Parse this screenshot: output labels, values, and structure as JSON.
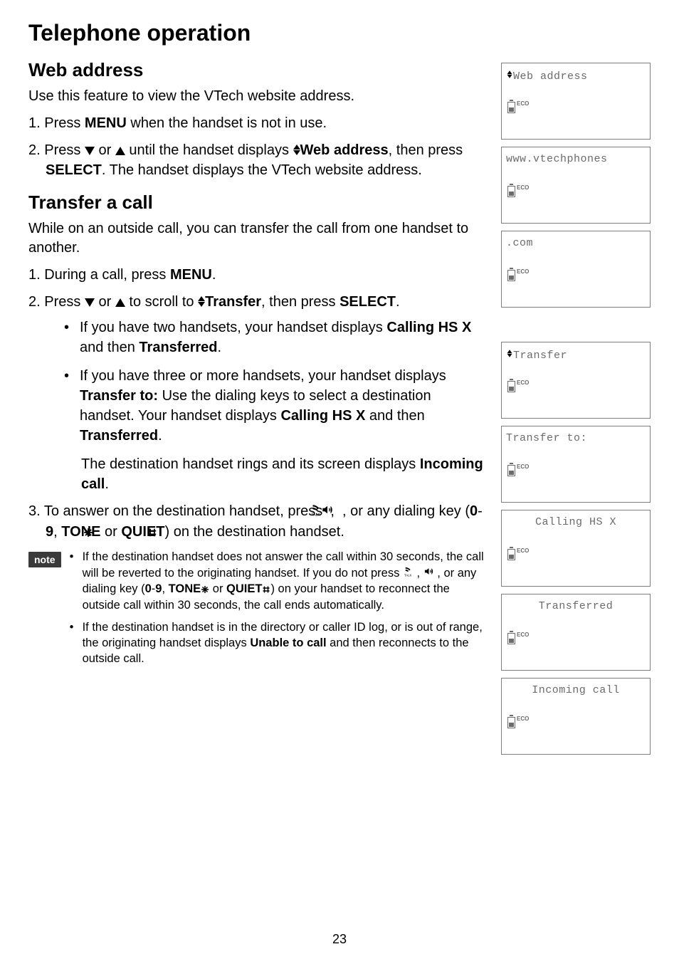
{
  "page_title": "Telephone operation",
  "page_number": "23",
  "section1": {
    "heading": "Web address",
    "intro": "Use this feature to view the VTech website address.",
    "step1_pre": "1. Press ",
    "step1_b": "MENU",
    "step1_post": " when the handset is not in use.",
    "step2_pre": "2. Press ",
    "step2_mid": " or ",
    "step2_mid2": " until the handset displays ",
    "step2_b": "Web address",
    "step2_post1": ", then press ",
    "step2_b2": "SELECT",
    "step2_post2": ". The handset displays the VTech website address."
  },
  "section2": {
    "heading": "Transfer a call",
    "intro": "While on an outside call, you can transfer the call from one handset to another.",
    "step1_pre": "1. During a call, press ",
    "step1_b": "MENU",
    "step1_post": ".",
    "step2_pre": "2. Press ",
    "step2_mid": " or ",
    "step2_mid2": " to scroll to ",
    "step2_b": "Transfer",
    "step2_post1": ", then press ",
    "step2_b2": "SELECT",
    "step2_post2": ".",
    "bullet1_pre": "If you have two handsets, your handset displays ",
    "bullet1_b1": "Calling HS X",
    "bullet1_mid": " and then ",
    "bullet1_b2": "Transferred",
    "bullet1_post": ".",
    "bullet2_pre": "If you have three or more handsets, your handset displays ",
    "bullet2_b1": "Transfer to:",
    "bullet2_mid1": " Use the dialing keys to select a destination handset. Your handset displays ",
    "bullet2_b2": "Calling HS X",
    "bullet2_mid2": " and then ",
    "bullet2_b3": "Transferred",
    "bullet2_post": ".",
    "sub_pre": "The destination handset rings and its screen displays ",
    "sub_b": "Incoming call",
    "sub_post": ".",
    "step3_pre": "3. To answer on the destination handset, press ",
    "step3_mid1": ", ",
    "step3_mid2": ", or any dialing key (",
    "step3_b1": "0",
    "step3_dash": "-",
    "step3_b2": "9",
    "step3_mid3": ", ",
    "step3_b3": "TONE",
    "step3_mid4": " or ",
    "step3_b4": "QUIET",
    "step3_post": ") on the destination handset."
  },
  "note": {
    "badge": "note",
    "n1_a": "If the destination handset does not answer the call within 30 seconds, the call will be reverted to the originating handset. If you do not press ",
    "n1_mid1": ", ",
    "n1_mid2": ", or any dialing key (",
    "n1_b1": "0",
    "n1_dash": "-",
    "n1_b2": "9",
    "n1_mid3": ", ",
    "n1_b3": "TONE",
    "n1_mid4": " or ",
    "n1_b4": "QUIET",
    "n1_post": ") on your handset to reconnect the outside call within 30 seconds, the call ends automatically.",
    "n2_a": "If the destination handset is in the directory or caller ID log, or is out of range, the originating handset displays ",
    "n2_b": "Unable to call",
    "n2_post": " and then reconnects to the outside call."
  },
  "screens": {
    "eco": "ECO",
    "s1": "Web address",
    "s2": "www.vtechphones",
    "s3": ".com",
    "s4": "Transfer",
    "s5": "Transfer to:",
    "s6": "Calling HS X",
    "s7": "Transferred",
    "s8": "Incoming call"
  }
}
